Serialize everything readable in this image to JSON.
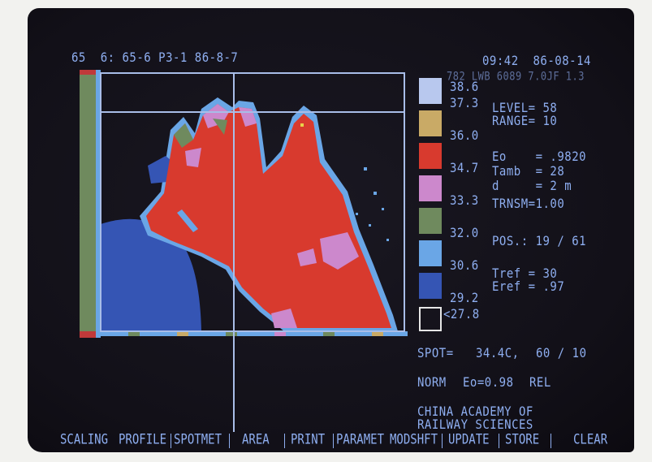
{
  "header": {
    "left": "65  6: 65-6 P3-1 86-8-7",
    "time_date": "09:42  86-08-14",
    "device_info": "782 LWB 6089 7.0JF 1.3"
  },
  "scale": [
    {
      "label": "38.6",
      "color": "#b8c8ee"
    },
    {
      "label": "37.3",
      "color": "#c9aa66"
    },
    {
      "label": "36.0",
      "color": "#d83a2e"
    },
    {
      "label": "34.7",
      "color": "#cc88cc"
    },
    {
      "label": "33.3",
      "color": "#6f8a5e"
    },
    {
      "label": "32.0",
      "color": "#6aa6e6"
    },
    {
      "label": "30.6",
      "color": "#3555b4"
    },
    {
      "label": "29.2",
      "color": ""
    },
    {
      "label": "<27.8",
      "color": "#0b0a10"
    }
  ],
  "params": {
    "level": "LEVEL= 58",
    "range": "RANGE= 10",
    "eo": "Eo    = .9820",
    "tamb": "Tamb  = 28",
    "d": "d     = 2 m",
    "trnsm": "TRNSM=1.00",
    "pos": "POS.: 19 / 61",
    "tref": "Tref = 30",
    "eref": "Eref = .97"
  },
  "spot": {
    "label": "SPOT=",
    "temp": "34.4C,",
    "coords": "60 / 10"
  },
  "mode": {
    "norm": "NORM",
    "eo": "Eo=0.98",
    "rel": "REL"
  },
  "institution": {
    "line1": "CHINA ACADEMY OF",
    "line2": "RAILWAY SCIENCES"
  },
  "menu": [
    "SCALING",
    "PROFILE",
    "SPOTMET",
    "AREA",
    "PRINT",
    "PARAMET",
    "MODSHFT",
    "UPDATE",
    "STORE",
    "CLEAR"
  ],
  "icons": {
    "thermal_image": "hand-thermogram"
  }
}
